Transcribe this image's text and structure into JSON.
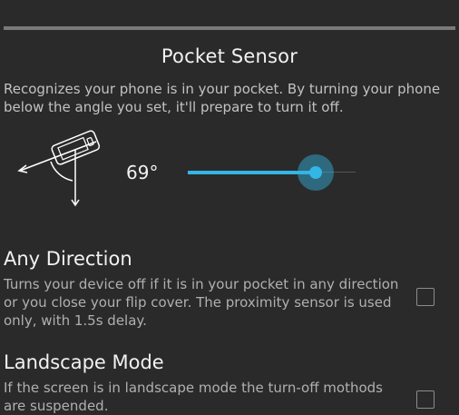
{
  "header": {
    "title": "Pocket Sensor",
    "description": "Recognizes your phone is in your pocket. By turning your phone below the angle you set, it'll prepare to turn it off."
  },
  "angle": {
    "label": "69°",
    "value": 69,
    "slider_fraction": 0.76
  },
  "preferences": [
    {
      "title": "Any Direction",
      "summary": "Turns your device off if it is in your pocket in any direction or you close your flip cover. The proximity sensor is used only, with 1.5s delay.",
      "checked": false
    },
    {
      "title": "Landscape Mode",
      "summary": "If the screen is in landscape mode the turn-off mothods are suspended.",
      "checked": false
    }
  ],
  "colors": {
    "background": "#2a2a2a",
    "accent": "#33b5e5",
    "divider": "#7a7a7a"
  }
}
